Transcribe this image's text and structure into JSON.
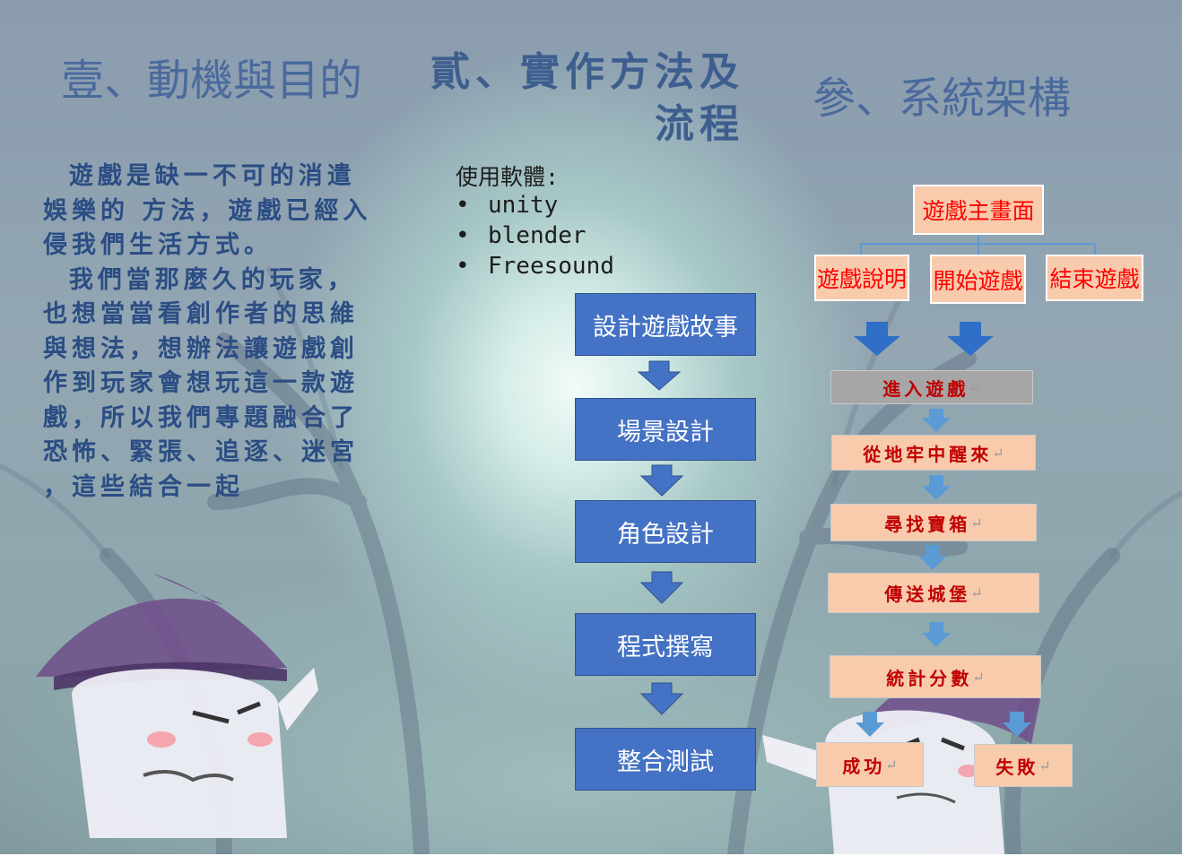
{
  "sections": {
    "one_title": "壹、動機與目的",
    "two_title_line1": "貳、實作方法及",
    "two_title_line2": "流程",
    "three_title": "參、系統架構"
  },
  "motivation": {
    "paragraph": "  遊戲是缺一不可的消遣娛樂的 方法，遊戲已經入侵我們生活方式。\n  我們當那麼久的玩家，也想當當看創作者的思維與想法，想辦法讓遊戲創作到玩家會想玩這一款遊戲，所以我們專題融合了恐怖、緊張、追逐、迷宮 ，這些結合一起"
  },
  "software": {
    "heading": "使用軟體:",
    "items": [
      "unity",
      "blender",
      "Freesound"
    ]
  },
  "process_flow": [
    "設計遊戲故事",
    "場景設計",
    "角色設計",
    "程式撰寫",
    "整合測試"
  ],
  "system": {
    "main_menu": "遊戲主畫面",
    "options": [
      "遊戲說明",
      "開始遊戲",
      "結束遊戲"
    ],
    "stages": [
      "進入遊戲",
      "從地牢中醒來",
      "尋找寶箱",
      "傳送城堡",
      "統計分數"
    ],
    "outcomes": [
      "成功",
      "失敗"
    ],
    "return_mark": "↵"
  },
  "colors": {
    "flow_box": "#4472c4",
    "arrow": "#4472c4",
    "system_box": "#f8cbad",
    "system_text": "#ff0000",
    "stage_text": "#c00000",
    "title": "#4a6a9c"
  }
}
